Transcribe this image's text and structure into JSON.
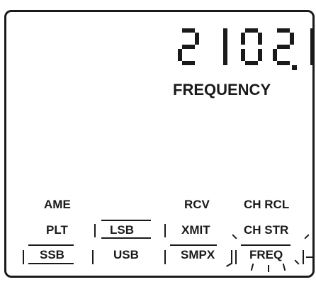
{
  "display": {
    "frequency_value": "2102.1",
    "frequency_label": "FREQUENCY"
  },
  "modes": {
    "ame": "AME",
    "plt": "PLT",
    "lsb": "LSB",
    "ssb": "SSB",
    "usb": "USB",
    "rcv": "RCV",
    "xmit": "XMIT",
    "smpx": "SMPX",
    "ch_rcl": "CH RCL",
    "ch_str": "CH STR",
    "freq": "FREQ"
  },
  "selected_mode": "FREQ"
}
